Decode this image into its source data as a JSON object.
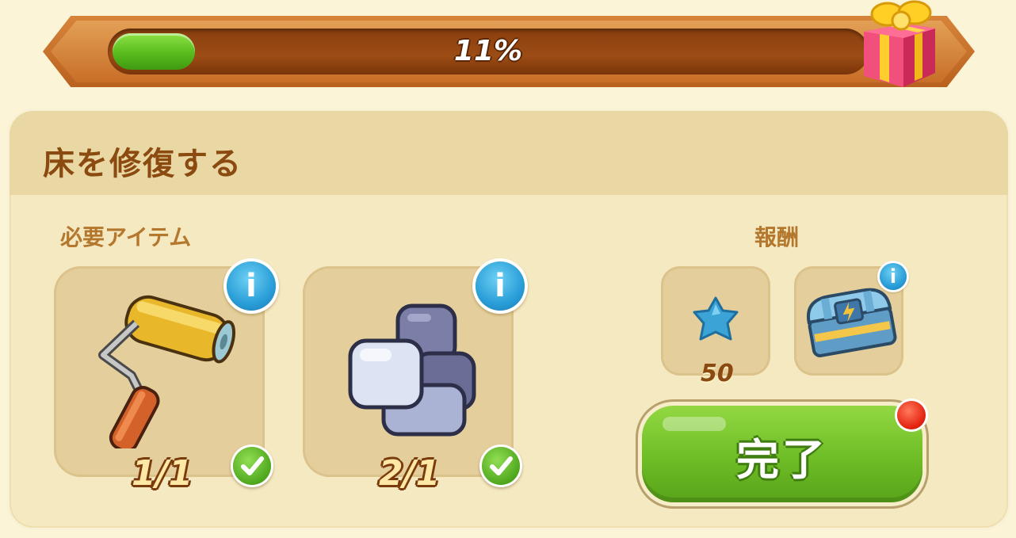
{
  "progress": {
    "percent_label": "11%",
    "fill_fraction": 0.11
  },
  "quest": {
    "title": "床を修復する",
    "required_items_label": "必要アイテム",
    "reward_label": "報酬",
    "items": [
      {
        "icon": "paint-roller-icon",
        "count": "1/1",
        "completed": true
      },
      {
        "icon": "stone-tiles-icon",
        "count": "2/1",
        "completed": true
      }
    ],
    "rewards": [
      {
        "icon": "blue-star-icon",
        "amount": "50"
      },
      {
        "icon": "energy-chest-icon",
        "amount": ""
      }
    ],
    "complete_button": "完了"
  },
  "icons": {
    "info": "i"
  },
  "colors": {
    "progress_green": "#58bb1d",
    "button_green": "#6ebd26",
    "title_brown": "#8a4a10",
    "info_blue": "#2a9ed8",
    "notification_red": "#e52410"
  }
}
